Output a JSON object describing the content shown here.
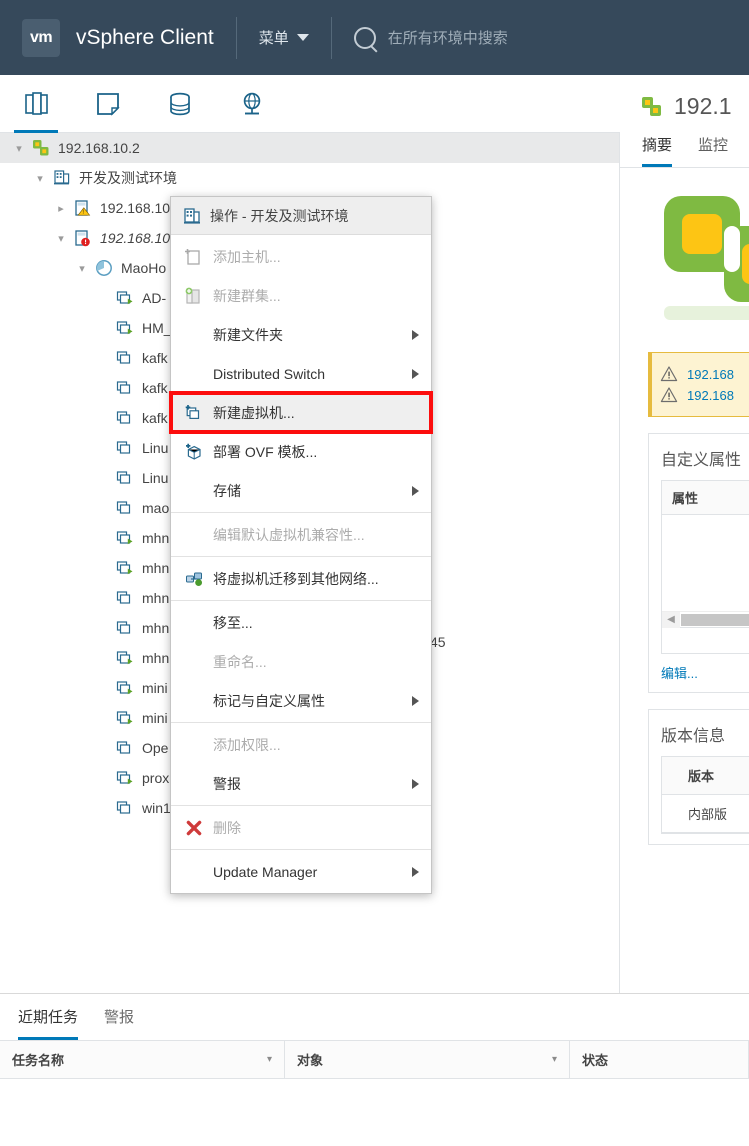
{
  "header": {
    "logo_text": "vm",
    "product": "vSphere Client",
    "menu_label": "菜单",
    "search_placeholder": "在所有环境中搜索"
  },
  "nav_icons": [
    {
      "name": "hosts-and-clusters-icon",
      "label": "主机和群集"
    },
    {
      "name": "vms-and-templates-icon",
      "label": "虚拟机和模板"
    },
    {
      "name": "storage-icon",
      "label": "存储"
    },
    {
      "name": "networking-icon",
      "label": "网络"
    }
  ],
  "tree": [
    {
      "label": "192.168.10.2",
      "icon": "vcenter-icon",
      "depth": 0,
      "twisty": "down",
      "selected": true,
      "italic": false
    },
    {
      "label": "开发及测试环境",
      "icon": "datacenter-icon",
      "depth": 1,
      "twisty": "down",
      "selected": false,
      "italic": false
    },
    {
      "label": "192.168.10",
      "icon": "host-warning-icon",
      "depth": 2,
      "twisty": "right",
      "selected": false,
      "italic": false
    },
    {
      "label": "192.168.10",
      "icon": "host-error-icon",
      "depth": 2,
      "twisty": "down",
      "selected": false,
      "italic": true
    },
    {
      "label": "MaoHo",
      "icon": "resource-pool-icon",
      "depth": 3,
      "twisty": "down",
      "selected": false,
      "italic": false
    },
    {
      "label": "AD-",
      "icon": "vm-on-icon",
      "depth": 4,
      "twisty": "",
      "selected": false,
      "italic": false
    },
    {
      "label": "HM_",
      "icon": "vm-on-icon",
      "depth": 4,
      "twisty": "",
      "selected": false,
      "italic": false
    },
    {
      "label": "kafk",
      "icon": "vm-off-icon",
      "depth": 4,
      "twisty": "",
      "selected": false,
      "italic": false
    },
    {
      "label": "kafk",
      "icon": "vm-off-icon",
      "depth": 4,
      "twisty": "",
      "selected": false,
      "italic": false
    },
    {
      "label": "kafk",
      "icon": "vm-off-icon",
      "depth": 4,
      "twisty": "",
      "selected": false,
      "italic": false
    },
    {
      "label": "Linu",
      "icon": "vm-off-icon",
      "depth": 4,
      "twisty": "",
      "selected": false,
      "italic": false
    },
    {
      "label": "Linu",
      "icon": "vm-off-icon",
      "depth": 4,
      "twisty": "",
      "selected": false,
      "italic": false
    },
    {
      "label": "mao",
      "icon": "vm-off-icon",
      "depth": 4,
      "twisty": "",
      "selected": false,
      "italic": false
    },
    {
      "label": "mhn",
      "icon": "vm-on-icon",
      "depth": 4,
      "twisty": "",
      "selected": false,
      "italic": false
    },
    {
      "label": "mhn",
      "icon": "vm-on-icon",
      "depth": 4,
      "twisty": "",
      "selected": false,
      "italic": false
    },
    {
      "label": "mhn",
      "icon": "vm-off-icon",
      "depth": 4,
      "twisty": "",
      "selected": false,
      "italic": false
    },
    {
      "label": "mhn",
      "icon": "vm-off-icon",
      "depth": 4,
      "twisty": "",
      "selected": false,
      "italic": false
    },
    {
      "label": "mhn",
      "icon": "vm-on-icon",
      "depth": 4,
      "twisty": "",
      "selected": false,
      "italic": false
    },
    {
      "label": "mini",
      "icon": "vm-on-icon",
      "depth": 4,
      "twisty": "",
      "selected": false,
      "italic": false
    },
    {
      "label": "mini",
      "icon": "vm-on-icon",
      "depth": 4,
      "twisty": "",
      "selected": false,
      "italic": false
    },
    {
      "label": "Ope",
      "icon": "vm-off-icon",
      "depth": 4,
      "twisty": "",
      "selected": false,
      "italic": false
    },
    {
      "label": "prox",
      "icon": "vm-on-icon",
      "depth": 4,
      "twisty": "",
      "selected": false,
      "italic": false
    },
    {
      "label": "win1",
      "icon": "vm-off-icon",
      "depth": 4,
      "twisty": "",
      "selected": false,
      "italic": false
    }
  ],
  "context_menu": {
    "header": "操作 - 开发及测试环境",
    "groups": [
      [
        {
          "label": "添加主机...",
          "icon": "add-host-icon",
          "disabled": true,
          "submenu": false,
          "highlight": false
        },
        {
          "label": "新建群集...",
          "icon": "new-cluster-icon",
          "disabled": true,
          "submenu": false,
          "highlight": false
        },
        {
          "label": "新建文件夹",
          "icon": "",
          "disabled": false,
          "submenu": true,
          "highlight": false
        },
        {
          "label": "Distributed Switch",
          "icon": "",
          "disabled": false,
          "submenu": true,
          "highlight": false
        },
        {
          "label": "新建虚拟机...",
          "icon": "new-vm-icon",
          "disabled": false,
          "submenu": false,
          "highlight": true
        },
        {
          "label": "部署 OVF 模板...",
          "icon": "deploy-ovf-icon",
          "disabled": false,
          "submenu": false,
          "highlight": false
        },
        {
          "label": "存储",
          "icon": "",
          "disabled": false,
          "submenu": true,
          "highlight": false
        }
      ],
      [
        {
          "label": "编辑默认虚拟机兼容性...",
          "icon": "",
          "disabled": true,
          "submenu": false,
          "highlight": false
        }
      ],
      [
        {
          "label": "将虚拟机迁移到其他网络...",
          "icon": "migrate-network-icon",
          "disabled": false,
          "submenu": false,
          "highlight": false
        }
      ],
      [
        {
          "label": "移至...",
          "icon": "",
          "disabled": false,
          "submenu": false,
          "highlight": false
        },
        {
          "label": "重命名...",
          "icon": "",
          "disabled": true,
          "submenu": false,
          "highlight": false
        },
        {
          "label": "标记与自定义属性",
          "icon": "",
          "disabled": false,
          "submenu": true,
          "highlight": false
        }
      ],
      [
        {
          "label": "添加权限...",
          "icon": "",
          "disabled": true,
          "submenu": false,
          "highlight": false
        },
        {
          "label": "警报",
          "icon": "",
          "disabled": false,
          "submenu": true,
          "highlight": false
        }
      ],
      [
        {
          "label": "删除",
          "icon": "delete-icon",
          "disabled": true,
          "submenu": false,
          "highlight": false
        }
      ],
      [
        {
          "label": "Update Manager",
          "icon": "",
          "disabled": false,
          "submenu": true,
          "highlight": false
        }
      ]
    ]
  },
  "detail": {
    "object_title": "192.1",
    "tabs": [
      {
        "label": "摘要",
        "active": true
      },
      {
        "label": "监控",
        "active": false
      }
    ],
    "warnings": [
      {
        "icon": "warning-triangle-icon",
        "text": "192.168"
      },
      {
        "icon": "warning-triangle-icon",
        "text": "192.168"
      }
    ],
    "custom_attributes": {
      "title": "自定义属性",
      "column_header": "属性",
      "edit_link": "编辑..."
    },
    "version_info": {
      "title": "版本信息",
      "rows": [
        "版本",
        "内部版"
      ]
    },
    "hidden_text_fragment": "45"
  },
  "bottom": {
    "tabs": [
      {
        "label": "近期任务",
        "active": true
      },
      {
        "label": "警报",
        "active": false
      }
    ],
    "columns": [
      "任务名称",
      "对象",
      "状态"
    ]
  },
  "colors": {
    "header_bg": "#36495b",
    "accent": "#0079b8",
    "highlight_outline": "#fc0d0d",
    "warn_bg": "#fdf3d2",
    "warn_border": "#e6bb3f",
    "vm_green": "#7fba42",
    "vm_yellow": "#fdc514"
  }
}
